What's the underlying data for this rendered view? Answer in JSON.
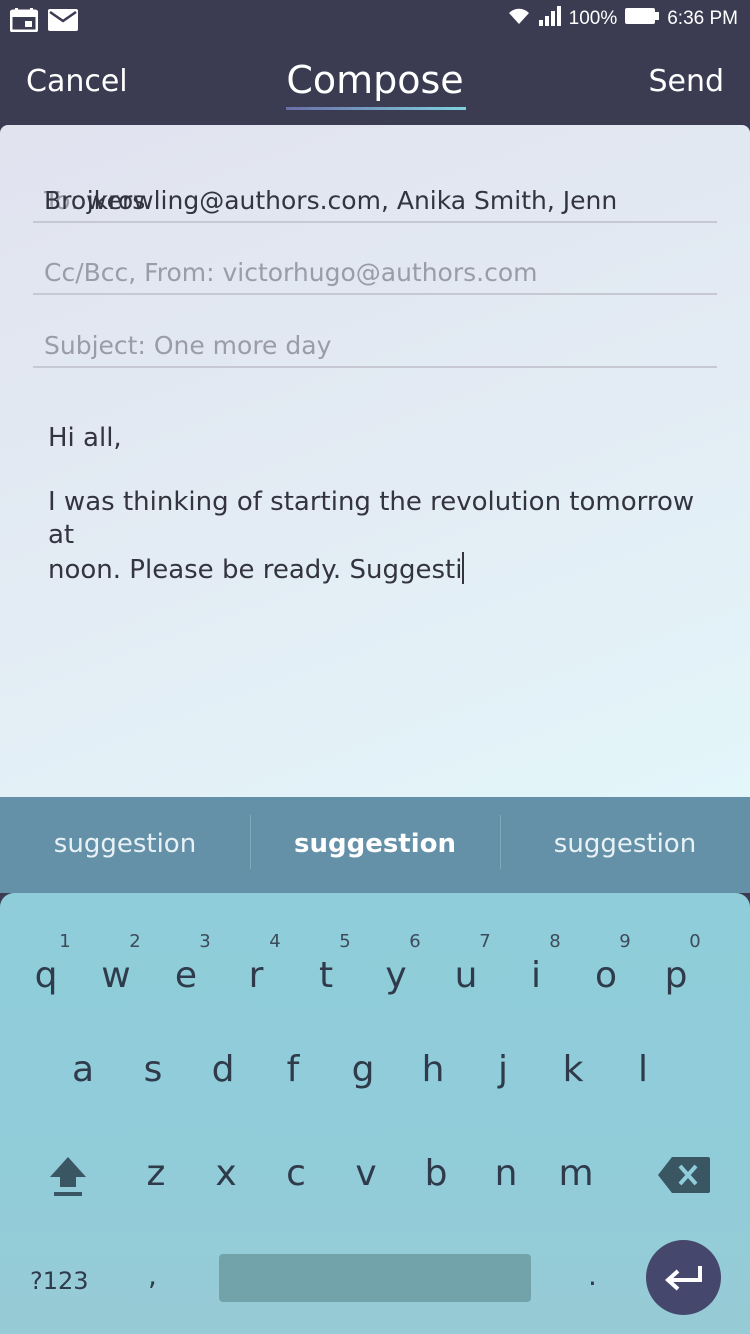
{
  "status_bar": {
    "icons_left": [
      "calendar-icon",
      "mail-icon"
    ],
    "battery": "100%",
    "time": "6:36 PM",
    "icons_right": [
      "wifi-icon",
      "signal-icon",
      "battery-icon"
    ]
  },
  "header": {
    "cancel_label": "Cancel",
    "title": "Compose",
    "send_label": "Send"
  },
  "compose": {
    "to_label": "To: ",
    "to_value": "jkrowling@authors.com, Anika Smith, Jenn Browers",
    "ccbcc_label": "Cc/Bcc, From: victorhugo@authors.com",
    "subject_label": "Subject: One more day",
    "body_greeting": "Hi all,",
    "body_line1": "I was thinking of starting the revolution tomorrow at",
    "body_line2": "noon.  Please be ready. Suggesti"
  },
  "suggestions": [
    "suggestion",
    "suggestion",
    "suggestion"
  ],
  "keyboard": {
    "row1": [
      {
        "num": "1",
        "ch": "q"
      },
      {
        "num": "2",
        "ch": "w"
      },
      {
        "num": "3",
        "ch": "e"
      },
      {
        "num": "4",
        "ch": "r"
      },
      {
        "num": "5",
        "ch": "t"
      },
      {
        "num": "6",
        "ch": "y"
      },
      {
        "num": "7",
        "ch": "u"
      },
      {
        "num": "8",
        "ch": "i"
      },
      {
        "num": "9",
        "ch": "o"
      },
      {
        "num": "0",
        "ch": "p"
      }
    ],
    "row2": [
      "a",
      "s",
      "d",
      "f",
      "g",
      "h",
      "j",
      "k",
      "l"
    ],
    "row3": [
      "z",
      "x",
      "c",
      "v",
      "b",
      "n",
      "m"
    ],
    "symbols_label": "?123",
    "comma_label": ",",
    "period_label": "."
  },
  "colors": {
    "header_bg": "#3b3c52",
    "suggest_bg": "#6591a8",
    "keyboard_bg": "#8ecdd9",
    "enter_bg": "#45486c"
  }
}
